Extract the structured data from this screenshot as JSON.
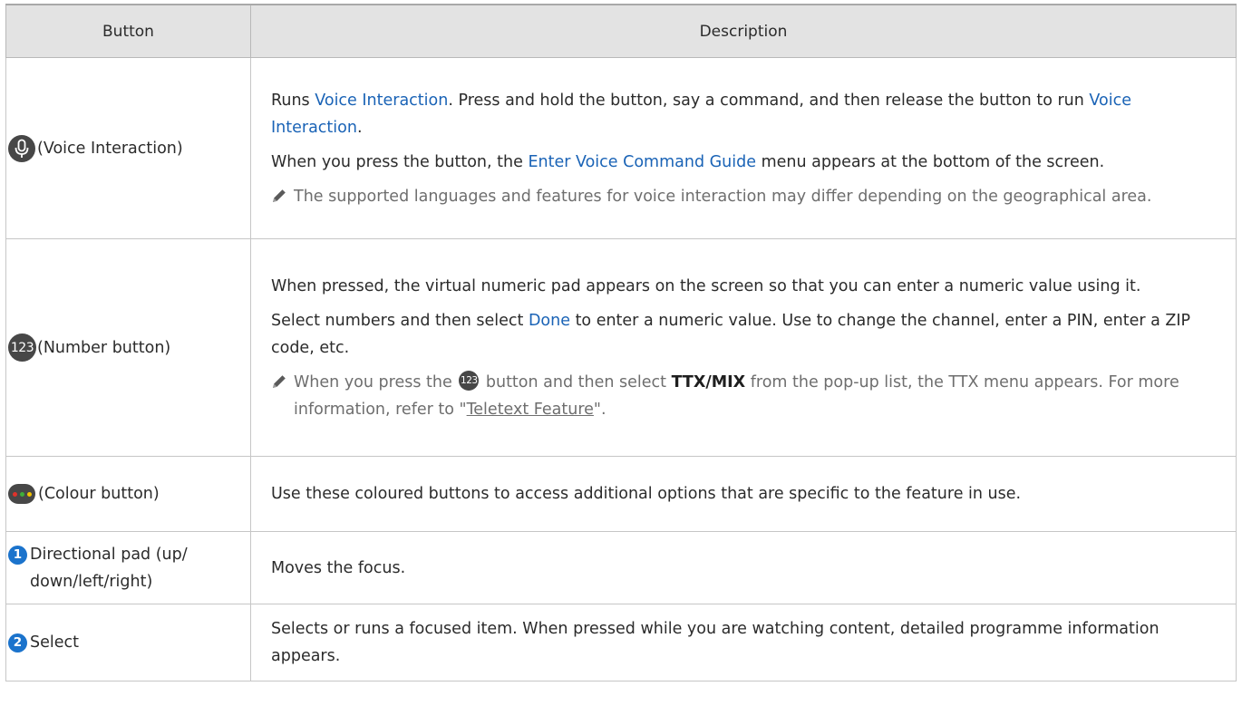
{
  "headers": {
    "button": "Button",
    "description": "Description"
  },
  "rows": [
    {
      "icon": "microphone-icon",
      "label": "(Voice Interaction)",
      "p1": {
        "a": "Runs ",
        "b": "Voice Interaction",
        "c": ". Press and hold the button, say a command, and then release the button to run ",
        "d": "Voice Interaction",
        "e": "."
      },
      "p2": {
        "a": "When you press the button, the ",
        "b": "Enter Voice Command Guide",
        "c": " menu appears at the bottom of the screen."
      },
      "note": "The supported languages and features for voice interaction may differ depending on the geographical area."
    },
    {
      "icon_text": "123",
      "label": "(Number button)",
      "p1": "When pressed, the virtual numeric pad appears on the screen so that you can enter a numeric value using it.",
      "p2": {
        "a": "Select numbers and then select ",
        "b": "Done",
        "c": " to enter a numeric value. Use to change the channel, enter a PIN, enter a ZIP code, etc."
      },
      "note": {
        "a": "When you press the ",
        "icon_text": "123",
        "b": " button and then select ",
        "c": "TTX/MIX",
        "d": " from the pop-up list, the TTX menu appears. For more information, refer to \"",
        "link": "Teletext Feature",
        "e": "\"."
      }
    },
    {
      "icon": "colour-button-icon",
      "dot_colors": [
        "#e0322b",
        "#3fae3a",
        "#f2c300"
      ],
      "label": "(Colour button)",
      "desc": "Use these coloured buttons to access additional options that are specific to the feature in use."
    },
    {
      "badge": "1",
      "label": "Directional pad (up/ down/left/right)",
      "desc": "Moves the focus."
    },
    {
      "badge": "2",
      "label": "Select",
      "desc": "Selects or runs a focused item. When pressed while you are watching content, detailed programme information appears."
    }
  ],
  "colors": {
    "highlight": "#1a63b6",
    "badge": "#1b73cc",
    "icon_bg": "#474747",
    "header_bg": "#e3e3e3"
  }
}
